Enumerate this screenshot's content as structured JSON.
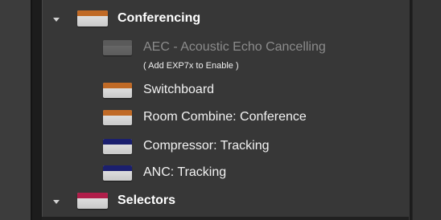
{
  "tree": {
    "groups": [
      {
        "label": "Conferencing",
        "band_color": "#c06a26",
        "expanded": true,
        "items": [
          {
            "label": "AEC - Acoustic Echo Cancelling",
            "band_color": "#5a5a5a",
            "enabled": false,
            "note": "( Add EXP7x to Enable )"
          },
          {
            "label": "Switchboard",
            "band_color": "#c06a26",
            "enabled": true
          },
          {
            "label": "Room Combine: Conference",
            "band_color": "#c06a26",
            "enabled": true
          },
          {
            "label": "Compressor: Tracking",
            "band_color": "#1b1f6e",
            "enabled": true
          },
          {
            "label": "ANC: Tracking",
            "band_color": "#1b1f6e",
            "enabled": true
          }
        ]
      },
      {
        "label": "Selectors",
        "band_color": "#b01e4a",
        "expanded": true,
        "items": []
      }
    ]
  }
}
